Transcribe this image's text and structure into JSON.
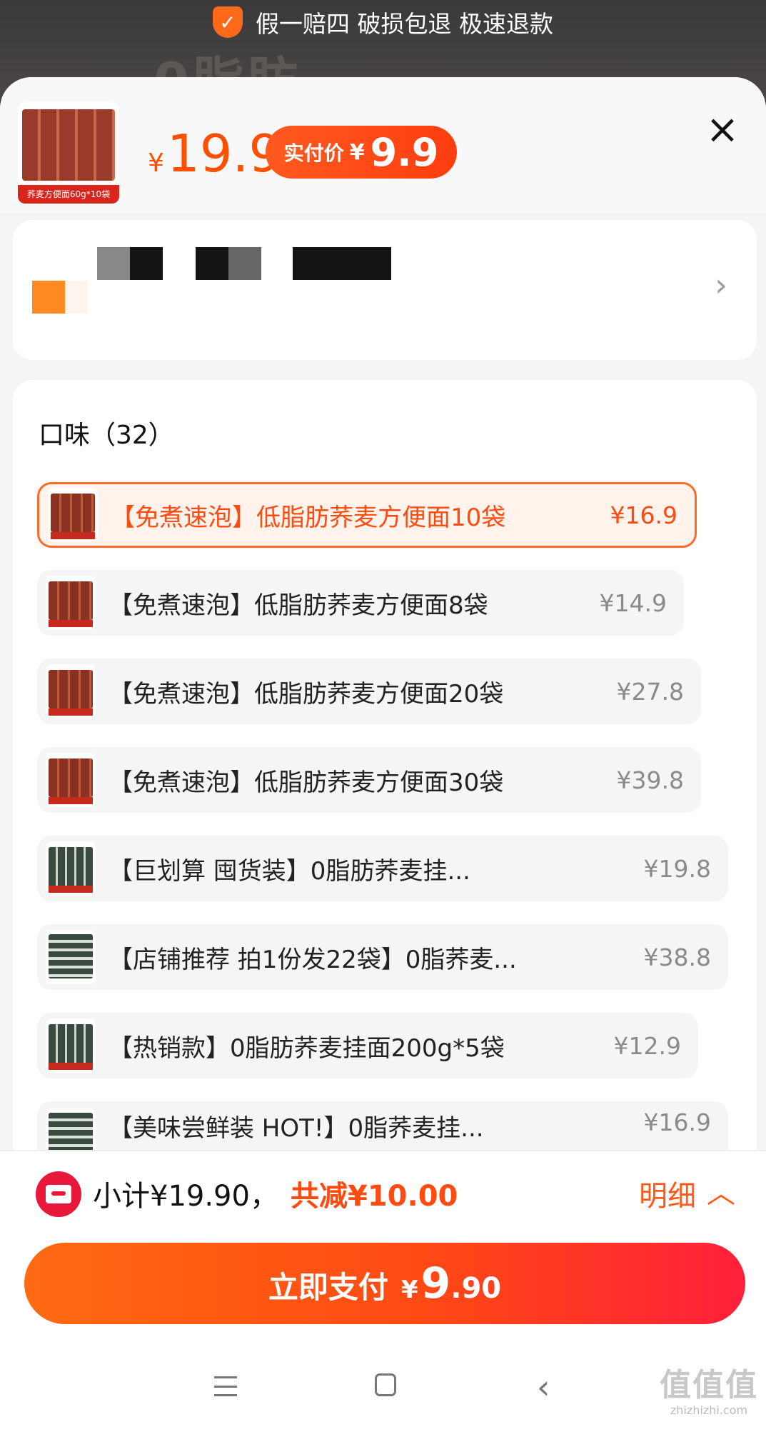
{
  "guarantee_banner": {
    "text": "假一赔四 破损包退 极速退款",
    "icon": "shield-check-icon"
  },
  "background": {
    "product_text": "0脂肪"
  },
  "header": {
    "price_symbol": "¥",
    "price": "19.9",
    "paid_label": "实付价",
    "paid_symbol": "¥",
    "paid_amount": "9.9",
    "thumb_caption": "荞麦方便面60g*10袋",
    "close_icon": "close-icon"
  },
  "flavor": {
    "title": "口味（32）",
    "options": [
      {
        "name": "【免煮速泡】低脂肪荞麦方便面10袋",
        "price": "¥16.9",
        "selected": true
      },
      {
        "name": "【免煮速泡】低脂肪荞麦方便面8袋",
        "price": "¥14.9",
        "selected": false
      },
      {
        "name": "【免煮速泡】低脂肪荞麦方便面20袋",
        "price": "¥27.8",
        "selected": false
      },
      {
        "name": "【免煮速泡】低脂肪荞麦方便面30袋",
        "price": "¥39.8",
        "selected": false
      },
      {
        "name": "【巨划算 囤货装】0脂肪荞麦挂...",
        "price": "¥19.8",
        "selected": false
      },
      {
        "name": "【店铺推荐 拍1份发22袋】0脂荞麦...",
        "price": "¥38.8",
        "selected": false
      },
      {
        "name": "【热销款】0脂肪荞麦挂面200g*5袋",
        "price": "¥12.9",
        "selected": false
      },
      {
        "name": "【美味尝鲜装 HOT!】0脂荞麦挂...",
        "price": "¥16.9",
        "selected": false
      }
    ]
  },
  "summary": {
    "subtotal": "小计¥19.90，",
    "discount": "共减¥10.00",
    "detail": "明细",
    "detail_icon": "chevron-up-icon"
  },
  "pay_button": {
    "label": "立即支付",
    "symbol": "¥",
    "int": "9",
    "dec": ".90"
  },
  "watermark": {
    "text": "值值值",
    "sub": "zhizhizhi.com"
  },
  "colors": {
    "accent": "#ff5000",
    "pay_gradient_end": "#ff1f3a",
    "coupon_red": "#e8183a"
  }
}
